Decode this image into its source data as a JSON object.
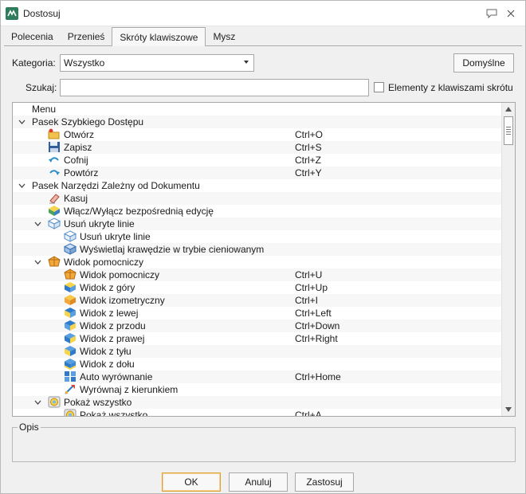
{
  "window": {
    "title": "Dostosuj"
  },
  "tabs": [
    {
      "label": "Polecenia"
    },
    {
      "label": "Przenieś"
    },
    {
      "label": "Skróty klawiszowe"
    },
    {
      "label": "Mysz"
    }
  ],
  "filters": {
    "category_label": "Kategoria:",
    "category_value": "Wszystko",
    "defaults_button": "Domyślne",
    "search_label": "Szukaj:",
    "search_value": "",
    "only_shortcuts_label": "Elementy z klawiszami skrótu"
  },
  "tree": {
    "header": "Menu",
    "rows": [
      {
        "name": "Pasek Szybkiego Dostępu",
        "shortcut": "",
        "depth": 0,
        "expander": "expanded",
        "icon": ""
      },
      {
        "name": "Otwórz",
        "shortcut": "Ctrl+O",
        "depth": 1,
        "expander": "",
        "icon": "open-folder-icon"
      },
      {
        "name": "Zapisz",
        "shortcut": "Ctrl+S",
        "depth": 1,
        "expander": "",
        "icon": "save-icon"
      },
      {
        "name": "Cofnij",
        "shortcut": "Ctrl+Z",
        "depth": 1,
        "expander": "",
        "icon": "undo-icon"
      },
      {
        "name": "Powtórz",
        "shortcut": "Ctrl+Y",
        "depth": 1,
        "expander": "",
        "icon": "redo-icon"
      },
      {
        "name": "Pasek Narzędzi Zależny od Dokumentu",
        "shortcut": "",
        "depth": 0,
        "expander": "expanded",
        "icon": ""
      },
      {
        "name": "Kasuj",
        "shortcut": "",
        "depth": 1,
        "expander": "",
        "icon": "eraser-icon"
      },
      {
        "name": "Włącz/Wyłącz bezpośrednią edycję",
        "shortcut": "",
        "depth": 1,
        "expander": "",
        "icon": "direct-edit-icon"
      },
      {
        "name": "Usuń ukryte linie",
        "shortcut": "",
        "depth": 1,
        "expander": "expanded",
        "icon": "hidden-lines-cube-icon"
      },
      {
        "name": "Usuń ukryte linie",
        "shortcut": "",
        "depth": 2,
        "expander": "",
        "icon": "hidden-lines-cube-icon"
      },
      {
        "name": "Wyświetlaj krawędzie w trybie cieniowanym",
        "shortcut": "",
        "depth": 2,
        "expander": "",
        "icon": "shaded-edges-cube-icon"
      },
      {
        "name": "Widok pomocniczy",
        "shortcut": "",
        "depth": 1,
        "expander": "expanded",
        "icon": "aux-view-icon"
      },
      {
        "name": "Widok pomocniczy",
        "shortcut": "Ctrl+U",
        "depth": 2,
        "expander": "",
        "icon": "aux-view-icon"
      },
      {
        "name": "Widok z góry",
        "shortcut": "Ctrl+Up",
        "depth": 2,
        "expander": "",
        "icon": "view-top-cube-icon"
      },
      {
        "name": "Widok izometryczny",
        "shortcut": "Ctrl+I",
        "depth": 2,
        "expander": "",
        "icon": "view-iso-cube-icon"
      },
      {
        "name": "Widok z lewej",
        "shortcut": "Ctrl+Left",
        "depth": 2,
        "expander": "",
        "icon": "view-left-cube-icon"
      },
      {
        "name": "Widok z przodu",
        "shortcut": "Ctrl+Down",
        "depth": 2,
        "expander": "",
        "icon": "view-front-cube-icon"
      },
      {
        "name": "Widok z prawej",
        "shortcut": "Ctrl+Right",
        "depth": 2,
        "expander": "",
        "icon": "view-right-cube-icon"
      },
      {
        "name": "Widok z tyłu",
        "shortcut": "",
        "depth": 2,
        "expander": "",
        "icon": "view-back-cube-icon"
      },
      {
        "name": "Widok z dołu",
        "shortcut": "",
        "depth": 2,
        "expander": "",
        "icon": "view-bottom-cube-icon"
      },
      {
        "name": "Auto wyrównanie",
        "shortcut": "Ctrl+Home",
        "depth": 2,
        "expander": "",
        "icon": "auto-align-icon"
      },
      {
        "name": "Wyrównaj z kierunkiem",
        "shortcut": "",
        "depth": 2,
        "expander": "",
        "icon": "align-direction-icon"
      },
      {
        "name": "Pokaż wszystko",
        "shortcut": "",
        "depth": 1,
        "expander": "expanded",
        "icon": "zoom-all-icon"
      },
      {
        "name": "Pokaż wszystko",
        "shortcut": "Ctrl+A",
        "depth": 2,
        "expander": "",
        "icon": "zoom-all-icon"
      }
    ]
  },
  "description": {
    "label": "Opis"
  },
  "footer": {
    "ok": "OK",
    "cancel": "Anuluj",
    "apply": "Zastosuj"
  }
}
